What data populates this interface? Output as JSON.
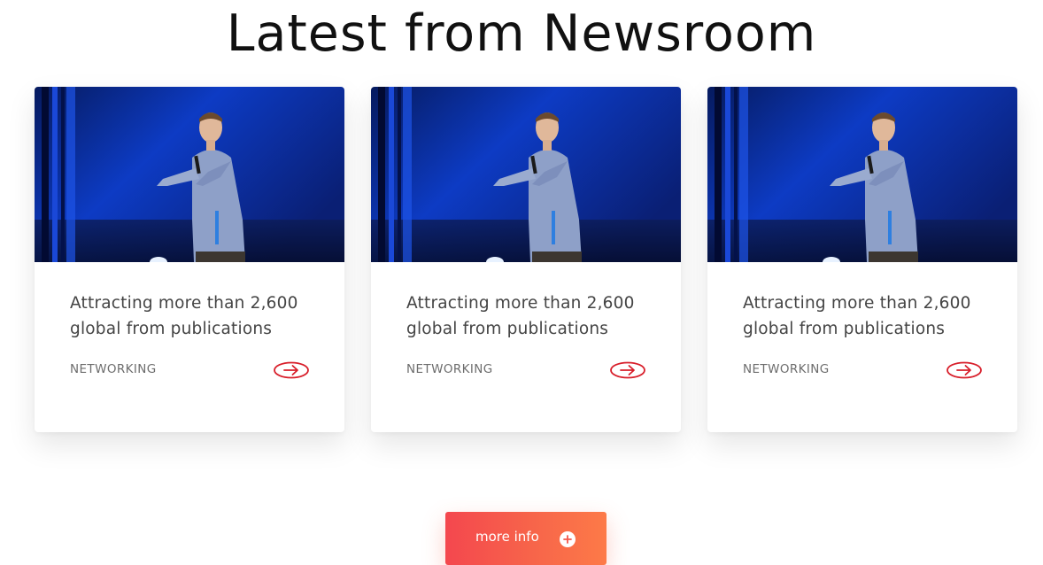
{
  "section": {
    "title": "Latest from Newsroom"
  },
  "cards": [
    {
      "title": "Attracting more than 2,600 global from publications",
      "category": "NETWORKING",
      "image_icon": "speaker-on-stage-photo",
      "arrow_icon": "arrow-right-circle-icon"
    },
    {
      "title": "Attracting more than 2,600 global from publications",
      "category": "NETWORKING",
      "image_icon": "speaker-on-stage-photo",
      "arrow_icon": "arrow-right-circle-icon"
    },
    {
      "title": "Attracting more than 2,600 global from publications",
      "category": "NETWORKING",
      "image_icon": "speaker-on-stage-photo",
      "arrow_icon": "arrow-right-circle-icon"
    }
  ],
  "more_button": {
    "label": "more info",
    "icon": "plus-circle-icon"
  },
  "colors": {
    "accent": "#d81e2a",
    "button_start": "#f4474e",
    "button_end": "#fd7a48",
    "title_text": "#111111",
    "body_text": "#444444"
  }
}
